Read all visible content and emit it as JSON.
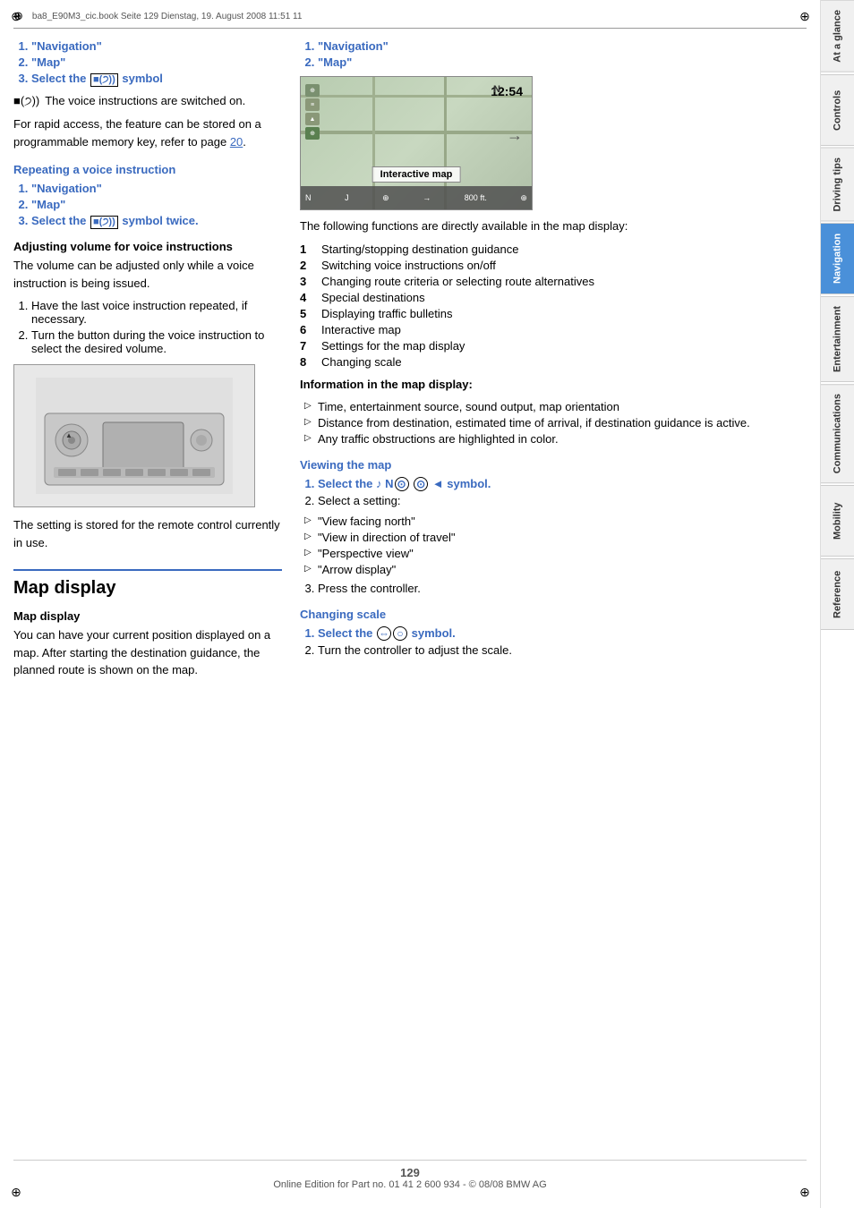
{
  "header": {
    "file_info": "ba8_E90M3_cic.book  Seite 129  Dienstag, 19. August 2008  11:51  11"
  },
  "sidebar": {
    "tabs": [
      {
        "id": "at-a-glance",
        "label": "At a glance",
        "active": false
      },
      {
        "id": "controls",
        "label": "Controls",
        "active": false
      },
      {
        "id": "driving-tips",
        "label": "Driving tips",
        "active": false
      },
      {
        "id": "navigation",
        "label": "Navigation",
        "active": true
      },
      {
        "id": "entertainment",
        "label": "Entertainment",
        "active": false
      },
      {
        "id": "communications",
        "label": "Communications",
        "active": false
      },
      {
        "id": "mobility",
        "label": "Mobility",
        "active": false
      },
      {
        "id": "reference",
        "label": "Reference",
        "active": false
      }
    ]
  },
  "left_col": {
    "steps_group1": [
      {
        "num": 1,
        "text": "\"Navigation\"",
        "style": "blue"
      },
      {
        "num": 2,
        "text": "\"Map\"",
        "style": "blue"
      },
      {
        "num": 3,
        "text": "Select the ■())) symbol",
        "style": "blue"
      }
    ],
    "note1": "■())) The voice instructions are switched on.",
    "note2": "For rapid access, the feature can be stored on a programmable memory key, refer to page 20.",
    "repeating_heading": "Repeating a voice instruction",
    "steps_group2": [
      {
        "num": 1,
        "text": "\"Navigation\"",
        "style": "blue"
      },
      {
        "num": 2,
        "text": "\"Map\"",
        "style": "blue"
      },
      {
        "num": 3,
        "text": "Select the ■())) symbol twice.",
        "style": "blue"
      }
    ],
    "volume_heading": "Adjusting volume for voice instructions",
    "volume_desc": "The volume can be adjusted only while a voice instruction is being issued.",
    "steps_group3": [
      {
        "num": 1,
        "text": "Have the last voice instruction repeated, if necessary.",
        "style": "black"
      },
      {
        "num": 2,
        "text": "Turn the button during the voice instruction to select the desired volume.",
        "style": "black"
      }
    ],
    "car_image_alt": "Car control panel image",
    "setting_note": "The setting is stored for the remote control currently in use.",
    "map_display_title": "Map display",
    "map_display_sub": "Map display",
    "map_display_desc": "You can have your current position displayed on a map. After starting the destination guidance, the planned route is shown on the map."
  },
  "right_col": {
    "steps_group1": [
      {
        "num": 1,
        "text": "\"Navigation\"",
        "style": "blue"
      },
      {
        "num": 2,
        "text": "\"Map\"",
        "style": "blue"
      }
    ],
    "map_image_alt": "Navigation map display showing 12:54, Interactive map, 800 ft",
    "map_time": "12:54",
    "map_label": "Interactive map",
    "map_distance": "800 ft.",
    "map_functions_intro": "The following functions are directly available in the map display:",
    "map_functions": [
      {
        "num": "1",
        "text": "Starting/stopping destination guidance"
      },
      {
        "num": "2",
        "text": "Switching voice instructions on/off"
      },
      {
        "num": "3",
        "text": "Changing route criteria or selecting route alternatives"
      },
      {
        "num": "4",
        "text": "Special destinations"
      },
      {
        "num": "5",
        "text": "Displaying traffic bulletins"
      },
      {
        "num": "6",
        "text": "Interactive map"
      },
      {
        "num": "7",
        "text": "Settings for the map display"
      },
      {
        "num": "8",
        "text": "Changing scale"
      }
    ],
    "info_heading": "Information in the map display:",
    "info_bullets": [
      "Time, entertainment source, sound output, map orientation",
      "Distance from destination, estimated time of arrival, if destination guidance is active.",
      "Any traffic obstructions are highlighted in color."
    ],
    "viewing_heading": "Viewing the map",
    "viewing_steps": [
      {
        "num": 1,
        "text": "Select the ♪ N⊙  ⊙  ◄ symbol.",
        "style": "blue"
      },
      {
        "num": 2,
        "text": "Select a setting:",
        "style": "black"
      }
    ],
    "viewing_bullets": [
      "\"View facing north\"",
      "\"View in direction of travel\"",
      "\"Perspective view\"",
      "\"Arrow display\""
    ],
    "viewing_step3": {
      "num": 3,
      "text": "Press the controller.",
      "style": "black"
    },
    "changing_scale_heading": "Changing scale",
    "scale_steps": [
      {
        "num": 1,
        "text": "Select the ⇔○  symbol.",
        "style": "blue"
      },
      {
        "num": 2,
        "text": "Turn the controller to adjust the scale.",
        "style": "black"
      }
    ]
  },
  "footer": {
    "page_number": "129",
    "copyright": "Online Edition for Part no. 01 41 2 600 934 - © 08/08 BMW AG"
  }
}
